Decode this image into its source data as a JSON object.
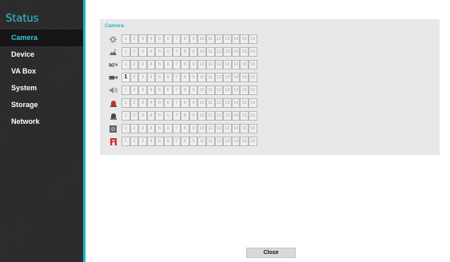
{
  "sidebar": {
    "title": "Status",
    "items": [
      {
        "label": "Camera",
        "active": true
      },
      {
        "label": "Device",
        "active": false
      },
      {
        "label": "VA Box",
        "active": false
      },
      {
        "label": "System",
        "active": false
      },
      {
        "label": "Storage",
        "active": false
      },
      {
        "label": "Network",
        "active": false
      }
    ]
  },
  "panel": {
    "title": "Camera",
    "channels": [
      "1",
      "2",
      "3",
      "4",
      "5",
      "6",
      "7",
      "8",
      "9",
      "10",
      "11",
      "12",
      "13",
      "14",
      "15",
      "16"
    ],
    "rows": [
      {
        "icon": "motion-icon",
        "active": []
      },
      {
        "icon": "tamper-icon",
        "active": []
      },
      {
        "icon": "video-loss-icon",
        "active": []
      },
      {
        "icon": "camera-record-icon",
        "active": [
          1
        ]
      },
      {
        "icon": "audio-icon",
        "active": []
      },
      {
        "icon": "alarm-red-icon",
        "active": []
      },
      {
        "icon": "alarm-icon",
        "active": []
      },
      {
        "icon": "covert-icon",
        "active": []
      },
      {
        "icon": "panic-icon",
        "active": []
      }
    ]
  },
  "close_label": "Close",
  "colors": {
    "accent": "#35c6dc",
    "sidebar_bg": "#2b2b2b",
    "panel_bg": "#e8e8e8"
  }
}
